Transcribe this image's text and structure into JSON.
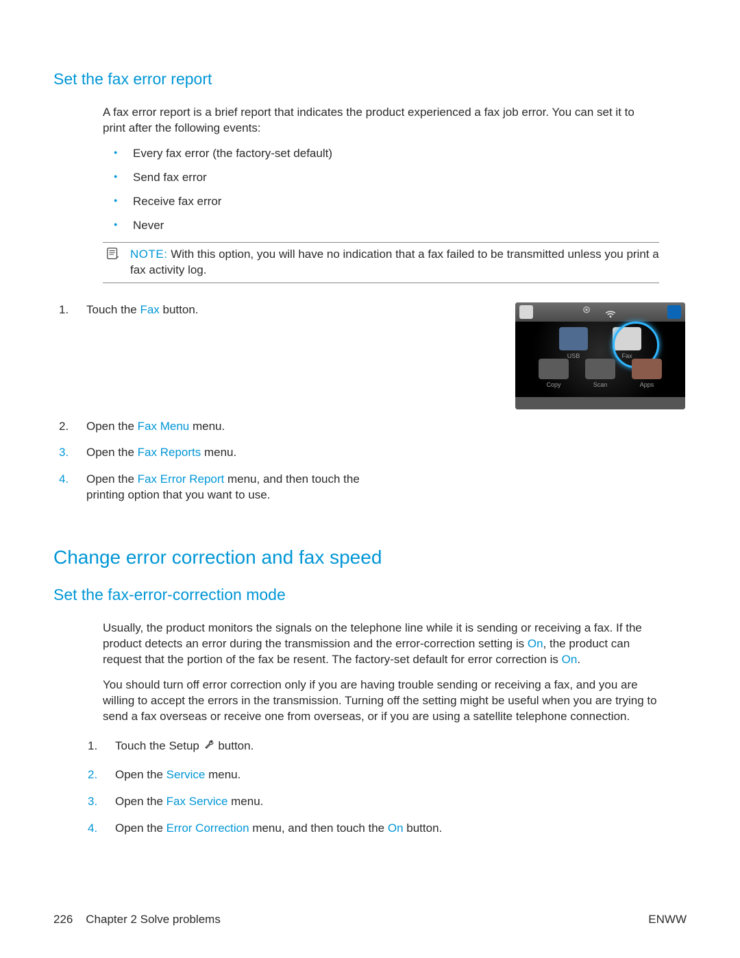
{
  "section1": {
    "title": "Set the fax error report",
    "intro": "A fax error report is a brief report that indicates the product experienced a fax job error. You can set it to print after the following events:",
    "events": [
      "Every fax error (the factory-set default)",
      "Send fax error",
      "Receive fax error",
      "Never"
    ],
    "note_label": "NOTE:",
    "note_text": "With this option, you will have no indication that a fax failed to be transmitted unless you print a fax activity log.",
    "steps": {
      "s1_a": "Touch the ",
      "s1_link": "Fax",
      "s1_b": " button.",
      "s2_a": "Open the ",
      "s2_link": "Fax Menu",
      "s2_b": " menu.",
      "s3_a": "Open the ",
      "s3_link": "Fax Reports",
      "s3_b": " menu.",
      "s4_a": "Open the ",
      "s4_link": "Fax Error Report",
      "s4_b": " menu, and then touch the printing option that you want to use."
    },
    "screen": {
      "usb": "USB",
      "fax": "Fax",
      "copy": "Copy",
      "scan": "Scan",
      "apps": "Apps"
    }
  },
  "section2": {
    "title": "Change error correction and fax speed"
  },
  "section3": {
    "title": "Set the fax-error-correction mode",
    "p1_a": "Usually, the product monitors the signals on the telephone line while it is sending or receiving a fax. If the product detects an error during the transmission and the error-correction setting is ",
    "p1_on1": "On",
    "p1_b": ", the product can request that the portion of the fax be resent. The factory-set default for error correction is ",
    "p1_on2": "On",
    "p1_c": ".",
    "p2": "You should turn off error correction only if you are having trouble sending or receiving a fax, and you are willing to accept the errors in the transmission. Turning off the setting might be useful when you are trying to send a fax overseas or receive one from overseas, or if you are using a satellite telephone connection.",
    "steps": {
      "s1_a": "Touch the Setup ",
      "s1_b": " button.",
      "s2_a": "Open the ",
      "s2_link": "Service",
      "s2_b": " menu.",
      "s3_a": "Open the ",
      "s3_link": "Fax Service",
      "s3_b": " menu.",
      "s4_a": "Open the ",
      "s4_link": "Error Correction",
      "s4_b": " menu, and then touch the ",
      "s4_on": "On",
      "s4_c": " button."
    }
  },
  "footer": {
    "page": "226",
    "chapter": "Chapter 2   Solve problems",
    "right": "ENWW"
  }
}
